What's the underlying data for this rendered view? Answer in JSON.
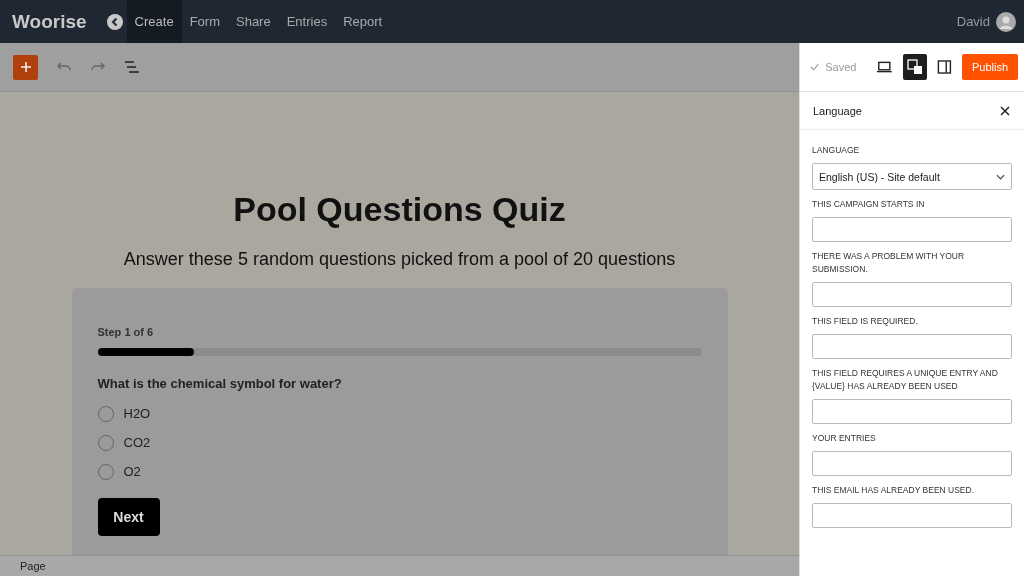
{
  "topbar": {
    "logo": "Woorise",
    "nav": [
      {
        "label": "Create",
        "selected": true
      },
      {
        "label": "Form",
        "selected": false
      },
      {
        "label": "Share",
        "selected": false
      },
      {
        "label": "Entries",
        "selected": false
      },
      {
        "label": "Report",
        "selected": false
      }
    ],
    "user": "David"
  },
  "editor": {
    "title": "Pool Questions Quiz",
    "subtitle": "Answer these 5 random questions picked from a pool of 20 questions",
    "step": "Step 1 of 6",
    "progress": {
      "level": 0.16
    },
    "question": "What is the chemical symbol for water?",
    "options": [
      {
        "label": "H2O",
        "selected": false
      },
      {
        "label": "CO2",
        "selected": false
      },
      {
        "label": "O2",
        "selected": false
      }
    ],
    "next": "Next"
  },
  "status_bar": "Page",
  "panel": {
    "saved": "Saved",
    "translate_selected": true,
    "publish": "Publish",
    "title": "Language",
    "language_label": "LANGUAGE",
    "language_value": "English (US) - Site default",
    "fields": [
      {
        "label": "THIS CAMPAIGN STARTS IN"
      },
      {
        "label": "THERE WAS A PROBLEM WITH YOUR SUBMISSION."
      },
      {
        "label": "THIS FIELD IS REQUIRED."
      },
      {
        "label": "THIS FIELD REQUIRES A UNIQUE ENTRY AND {VALUE} HAS ALREADY BEEN USED"
      },
      {
        "label": "YOUR ENTRIES"
      },
      {
        "label": "THIS EMAIL HAS ALREADY BEEN USED."
      }
    ]
  }
}
